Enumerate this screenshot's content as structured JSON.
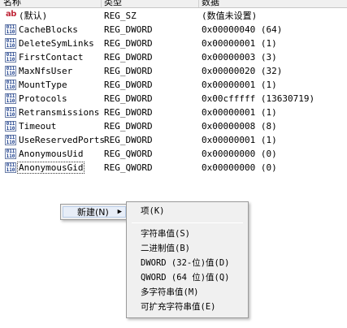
{
  "columns": {
    "name": "名称",
    "type": "类型",
    "data": "数据"
  },
  "rows": [
    {
      "icon": "string-value-icon",
      "icon_glyph": "ab",
      "name": "(默认)",
      "type": "REG_SZ",
      "data": "(数值未设置)"
    },
    {
      "icon": "binary-value-icon",
      "icon_glyph": "011\n110",
      "name": "CacheBlocks",
      "type": "REG_DWORD",
      "data": "0x00000040 (64)"
    },
    {
      "icon": "binary-value-icon",
      "icon_glyph": "011\n110",
      "name": "DeleteSymLinks",
      "type": "REG_DWORD",
      "data": "0x00000001 (1)"
    },
    {
      "icon": "binary-value-icon",
      "icon_glyph": "011\n110",
      "name": "FirstContact",
      "type": "REG_DWORD",
      "data": "0x00000003 (3)"
    },
    {
      "icon": "binary-value-icon",
      "icon_glyph": "011\n110",
      "name": "MaxNfsUser",
      "type": "REG_DWORD",
      "data": "0x00000020 (32)"
    },
    {
      "icon": "binary-value-icon",
      "icon_glyph": "011\n110",
      "name": "MountType",
      "type": "REG_DWORD",
      "data": "0x00000001 (1)"
    },
    {
      "icon": "binary-value-icon",
      "icon_glyph": "011\n110",
      "name": "Protocols",
      "type": "REG_DWORD",
      "data": "0x00cfffff (13630719)"
    },
    {
      "icon": "binary-value-icon",
      "icon_glyph": "011\n110",
      "name": "Retransmissions",
      "type": "REG_DWORD",
      "data": "0x00000001 (1)"
    },
    {
      "icon": "binary-value-icon",
      "icon_glyph": "011\n110",
      "name": "Timeout",
      "type": "REG_DWORD",
      "data": "0x00000008 (8)"
    },
    {
      "icon": "binary-value-icon",
      "icon_glyph": "011\n110",
      "name": "UseReservedPorts",
      "type": "REG_DWORD",
      "data": "0x00000001 (1)"
    },
    {
      "icon": "binary-value-icon",
      "icon_glyph": "011\n110",
      "name": "AnonymousUid",
      "type": "REG_QWORD",
      "data": "0x00000000 (0)"
    },
    {
      "icon": "binary-value-icon",
      "icon_glyph": "011\n110",
      "name": "AnonymousGid",
      "type": "REG_QWORD",
      "data": "0x00000000 (0)",
      "selected": true
    }
  ],
  "context_menu": {
    "new_label": "新建(N)",
    "submenu_arrow": "▶"
  },
  "new_submenu": {
    "key": "项(K)",
    "string_value": "字符串值(S)",
    "binary_value": "二进制值(B)",
    "dword_value": "DWORD (32-位)值(D)",
    "qword_value": "QWORD (64 位)值(Q)",
    "multi_string_value": "多字符串值(M)",
    "expandable_string_value": "可扩充字符串值(E)"
  }
}
